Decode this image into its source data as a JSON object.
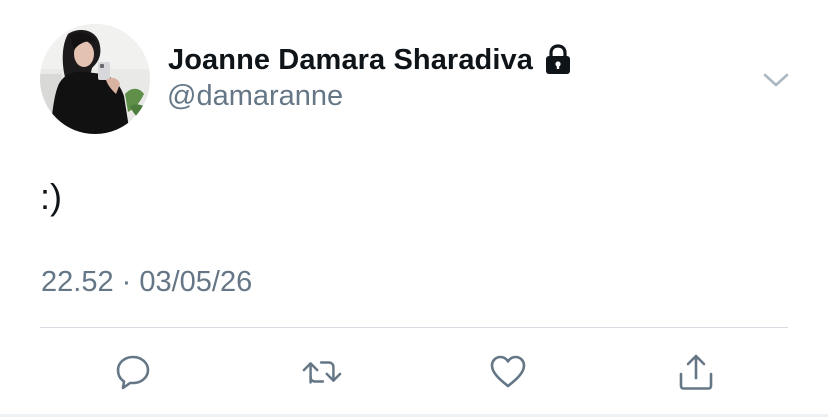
{
  "user": {
    "display_name": "Joanne Damara Sharadiva",
    "handle": "@damaranne",
    "protected": true
  },
  "tweet": {
    "text": ":)",
    "timestamp": "22.52 · 03/05/26"
  },
  "icons": {
    "lock": "lock-icon",
    "more": "chevron-down-icon",
    "reply": "reply-icon",
    "retweet": "retweet-icon",
    "like": "heart-icon",
    "share": "share-icon"
  },
  "colors": {
    "text": "#0f1419",
    "secondary": "#657786",
    "divider": "#d7dde2",
    "icon": "#657786"
  }
}
